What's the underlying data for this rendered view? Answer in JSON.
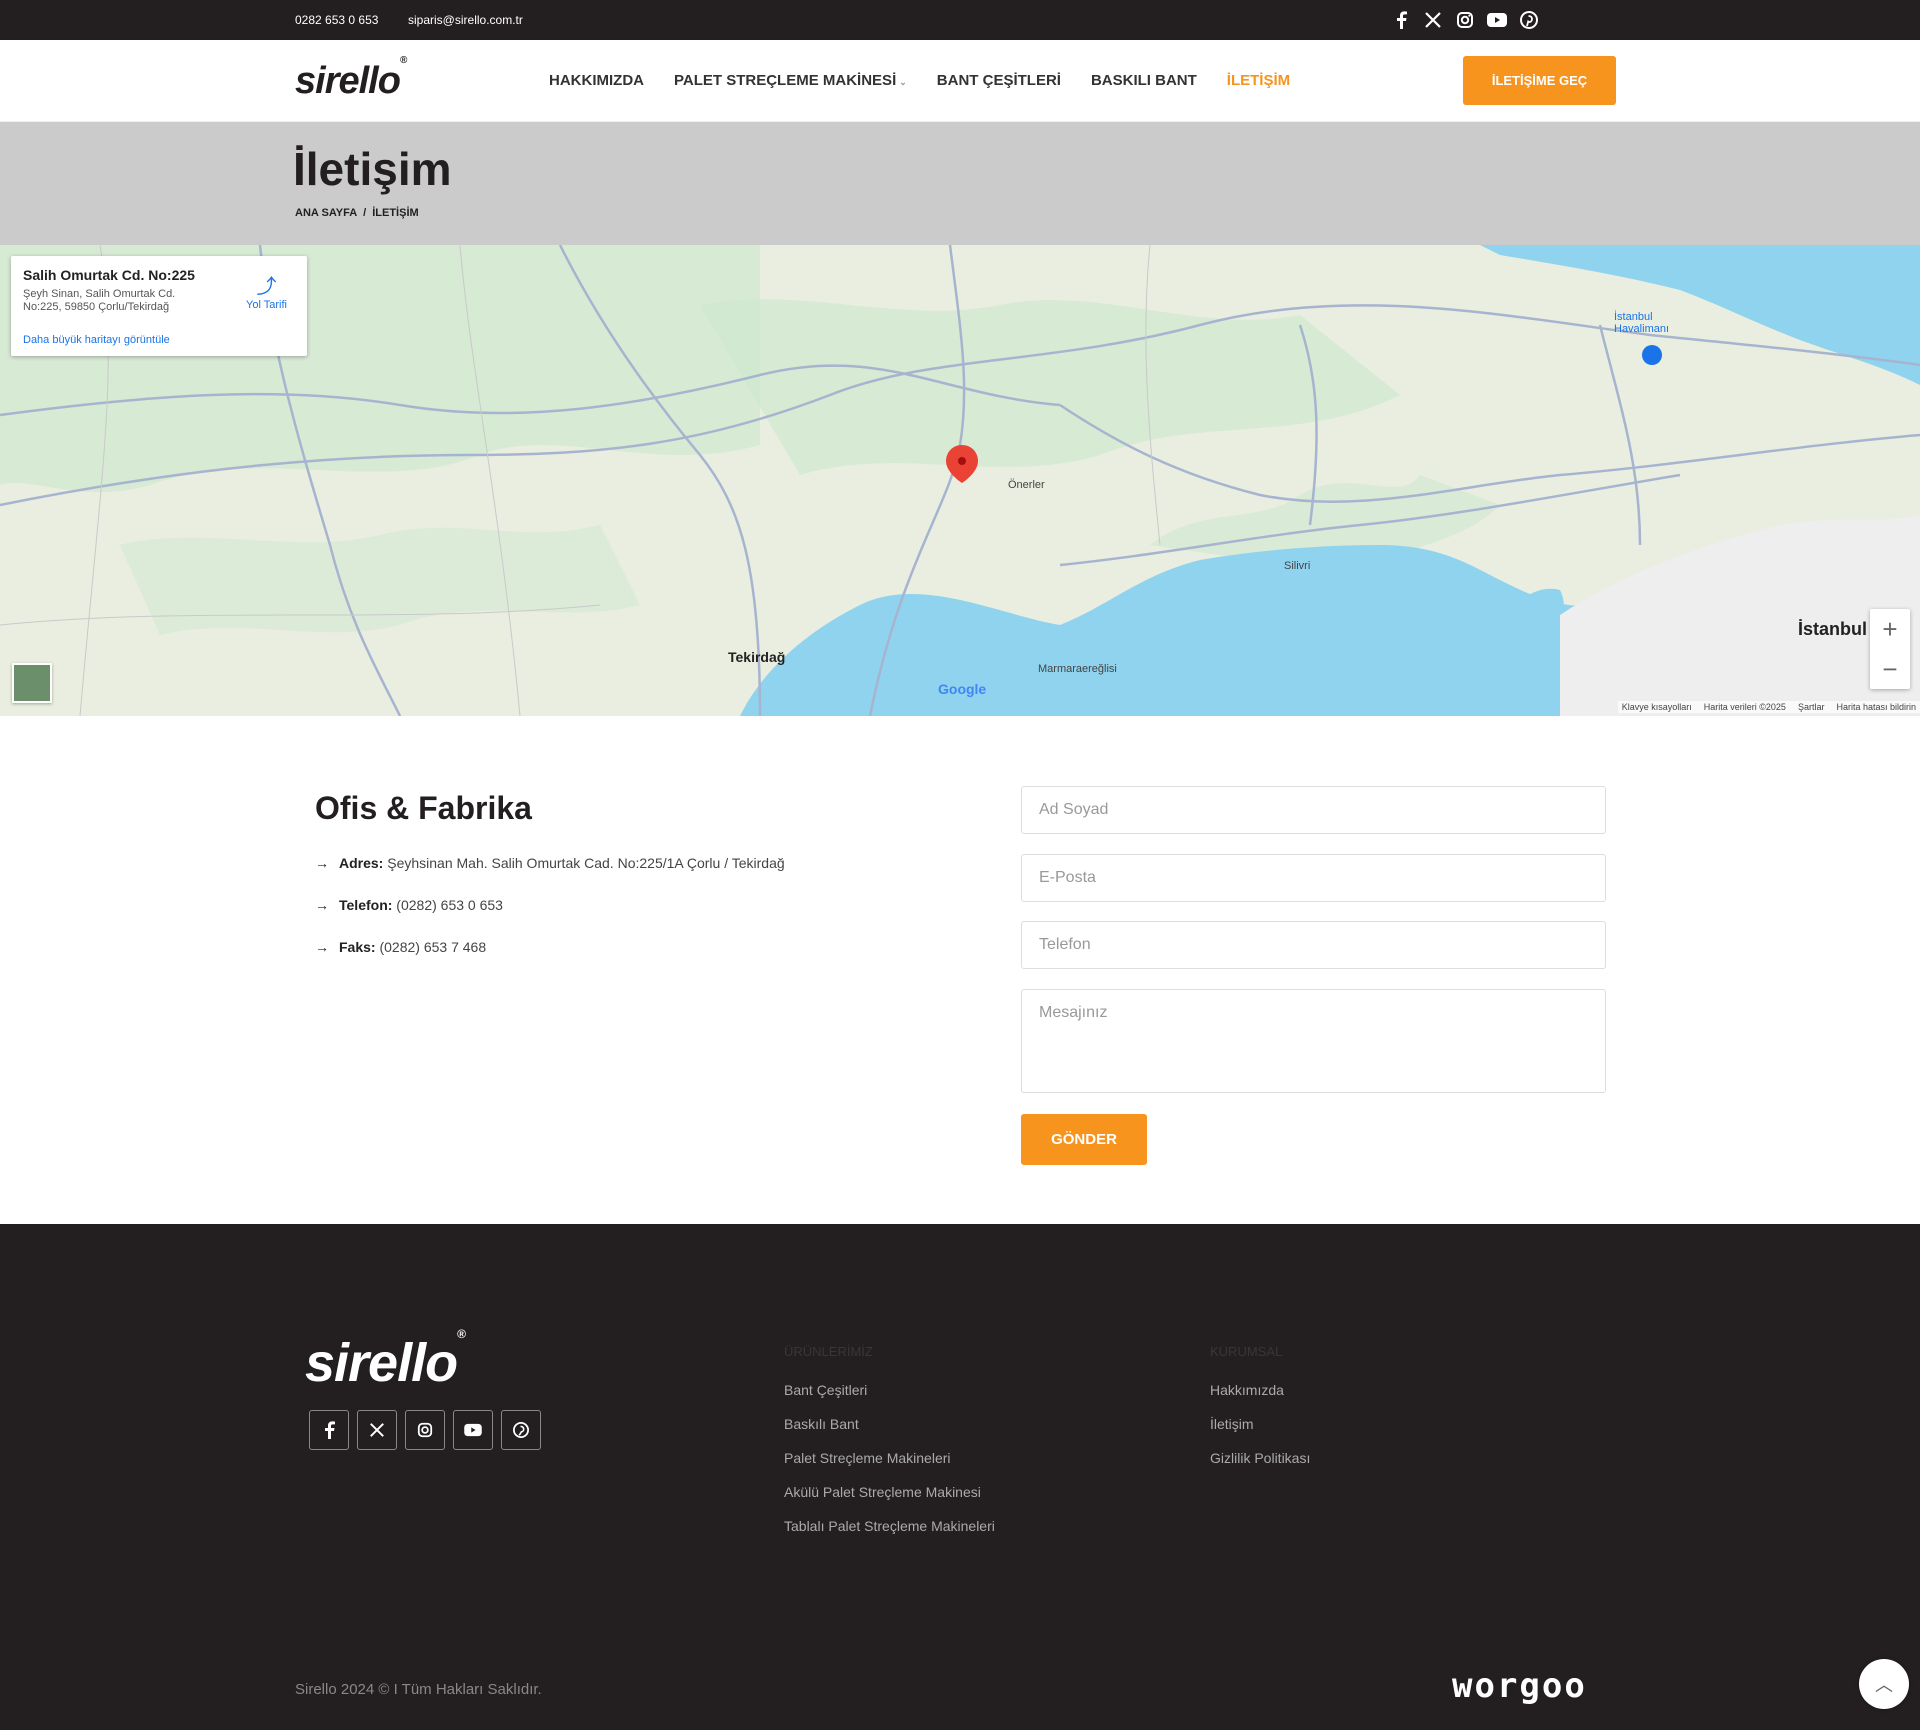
{
  "topbar": {
    "phone": "0282 653 0 653",
    "email": "siparis@sirello.com.tr",
    "socials": [
      "facebook-icon",
      "x-icon",
      "instagram-icon",
      "youtube-icon",
      "pinterest-icon"
    ]
  },
  "header": {
    "logo": "sirello",
    "nav": [
      {
        "label": "HAKKIMIZDA",
        "active": false
      },
      {
        "label": "PALET STREÇLEME MAKİNESİ",
        "active": false,
        "dropdown": true
      },
      {
        "label": "BANT ÇEŞİTLERİ",
        "active": false
      },
      {
        "label": "BASKILI BANT",
        "active": false
      },
      {
        "label": "İLETİŞİM",
        "active": true
      }
    ],
    "cta": "İLETİŞİME GEÇ"
  },
  "page": {
    "title": "İletişim",
    "breadcrumb": [
      "ANA SAYFA",
      "İLETİŞİM"
    ]
  },
  "map": {
    "card_title": "Salih Omurtak Cd. No:225",
    "card_address": "Şeyh Sinan, Salih Omurtak Cd. No:225, 59850 Çorlu/Tekirdağ",
    "card_link": "Daha büyük haritayı görüntüle",
    "directions": "Yol Tarifi",
    "labels": {
      "tekirdag": "Tekirdağ",
      "istanbul": "İstanbul",
      "corlu_area": "Önerler",
      "silivri": "Silivri",
      "marmaraereglisi": "Marmaraereğlisi",
      "havalimani": "İstanbul Havalimanı"
    },
    "zoom_in": "+",
    "zoom_out": "−",
    "google": "Google",
    "attribution": [
      "Klavye kısayolları",
      "Harita verileri ©2025",
      "Şartlar",
      "Harita hatası bildirin"
    ]
  },
  "contact": {
    "heading": "Ofis & Fabrika",
    "address_label": "Adres:",
    "address": "Şeyhsinan Mah. Salih Omurtak Cad. No:225/1A Çorlu / Tekirdağ",
    "phone_label": "Telefon:",
    "phone": "(0282) 653 0 653",
    "fax_label": "Faks:",
    "fax": "(0282) 653 7 468"
  },
  "form": {
    "name_placeholder": "Ad Soyad",
    "email_placeholder": "E-Posta",
    "phone_placeholder": "Telefon",
    "message_placeholder": "Mesajınız",
    "submit": "GÖNDER"
  },
  "footer": {
    "logo": "sirello",
    "products_heading": "ÜRÜNLERİMİZ",
    "products": [
      "Bant Çeşitleri",
      "Baskılı Bant",
      "Palet Streçleme Makineleri",
      "Akülü Palet Streçleme Makinesi",
      "Tablalı Palet Streçleme Makineleri"
    ],
    "corporate_heading": "KURUMSAL",
    "corporate": [
      "Hakkımızda",
      "İletişim",
      "Gizlilik Politikası"
    ],
    "copyright": "Sirello 2024 © I Tüm Hakları Saklıdır.",
    "agency": "worgoo"
  },
  "colors": {
    "accent": "#f7941d",
    "dark": "#231f20",
    "title_band": "#cbcbcb",
    "sea": "#8fd3ef",
    "land": "#e9eee0"
  }
}
